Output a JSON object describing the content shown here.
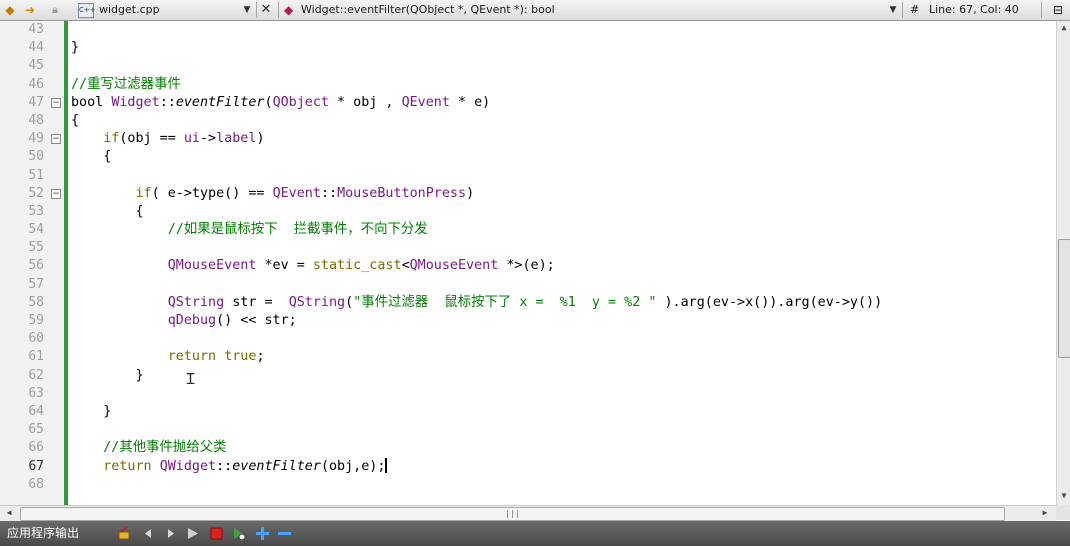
{
  "toolbar": {
    "file_name": "widget.cpp",
    "file_icon_text": "C++",
    "function_signature": "Widget::eventFilter(QObject *, QEvent *): bool",
    "hash_symbol": "#",
    "position": "Line: 67, Col: 40"
  },
  "editor": {
    "lines": [
      {
        "num": "43",
        "code": []
      },
      {
        "num": "44",
        "code": [
          [
            "p",
            "}"
          ]
        ]
      },
      {
        "num": "45",
        "code": []
      },
      {
        "num": "46",
        "code": [
          [
            "cm",
            "//重写过滤器事件"
          ]
        ]
      },
      {
        "num": "47",
        "fold": "-",
        "code": [
          [
            "p",
            "bool "
          ],
          [
            "ty",
            "Widget"
          ],
          [
            "p",
            "::"
          ],
          [
            "fn",
            "eventFilter"
          ],
          [
            "p",
            "("
          ],
          [
            "ty",
            "QObject"
          ],
          [
            "p",
            " * obj , "
          ],
          [
            "ty",
            "QEvent"
          ],
          [
            "p",
            " * e)"
          ]
        ]
      },
      {
        "num": "48",
        "code": [
          [
            "p",
            "{"
          ]
        ]
      },
      {
        "num": "49",
        "fold": "-",
        "code": [
          [
            "p",
            "    "
          ],
          [
            "kw",
            "if"
          ],
          [
            "p",
            "(obj == "
          ],
          [
            "ty",
            "ui"
          ],
          [
            "p",
            "->"
          ],
          [
            "ty",
            "label"
          ],
          [
            "p",
            ")"
          ]
        ]
      },
      {
        "num": "50",
        "code": [
          [
            "p",
            "    {"
          ]
        ]
      },
      {
        "num": "51",
        "code": []
      },
      {
        "num": "52",
        "fold": "-",
        "code": [
          [
            "p",
            "        "
          ],
          [
            "kw",
            "if"
          ],
          [
            "p",
            "( e->type() == "
          ],
          [
            "ty",
            "QEvent"
          ],
          [
            "p",
            "::"
          ],
          [
            "ty",
            "MouseButtonPress"
          ],
          [
            "p",
            ")"
          ]
        ]
      },
      {
        "num": "53",
        "code": [
          [
            "p",
            "        {"
          ]
        ]
      },
      {
        "num": "54",
        "code": [
          [
            "p",
            "            "
          ],
          [
            "cm",
            "//如果是鼠标按下  拦截事件，不向下分发"
          ]
        ]
      },
      {
        "num": "55",
        "code": []
      },
      {
        "num": "56",
        "code": [
          [
            "p",
            "            "
          ],
          [
            "ty",
            "QMouseEvent"
          ],
          [
            "p",
            " *ev = "
          ],
          [
            "kw",
            "static_cast"
          ],
          [
            "p",
            "<"
          ],
          [
            "ty",
            "QMouseEvent"
          ],
          [
            "p",
            " *>(e);"
          ]
        ]
      },
      {
        "num": "57",
        "code": []
      },
      {
        "num": "58",
        "code": [
          [
            "p",
            "            "
          ],
          [
            "ty",
            "QString"
          ],
          [
            "p",
            " str =  "
          ],
          [
            "ty",
            "QString"
          ],
          [
            "p",
            "("
          ],
          [
            "st",
            "\"事件过滤器  鼠标按下了 x =  %1  y = %2 \""
          ],
          [
            "p",
            " ).arg(ev->x()).arg(ev->y())"
          ]
        ]
      },
      {
        "num": "59",
        "code": [
          [
            "p",
            "            "
          ],
          [
            "ty",
            "qDebug"
          ],
          [
            "p",
            "() << str;"
          ]
        ]
      },
      {
        "num": "60",
        "code": []
      },
      {
        "num": "61",
        "code": [
          [
            "p",
            "            "
          ],
          [
            "kw",
            "return"
          ],
          [
            "p",
            " "
          ],
          [
            "kw",
            "true"
          ],
          [
            "p",
            ";"
          ]
        ]
      },
      {
        "num": "62",
        "code": [
          [
            "p",
            "        }"
          ]
        ]
      },
      {
        "num": "63",
        "code": []
      },
      {
        "num": "64",
        "code": [
          [
            "p",
            "    }"
          ]
        ]
      },
      {
        "num": "65",
        "code": []
      },
      {
        "num": "66",
        "code": [
          [
            "p",
            "    "
          ],
          [
            "cm",
            "//其他事件抛给父类"
          ]
        ]
      },
      {
        "num": "67",
        "current": true,
        "cursor": true,
        "code": [
          [
            "p",
            "    "
          ],
          [
            "kw",
            "return"
          ],
          [
            "p",
            " "
          ],
          [
            "ty",
            "QWidget"
          ],
          [
            "p",
            "::"
          ],
          [
            "fn",
            "eventFilter"
          ],
          [
            "p",
            "(obj,e);"
          ]
        ]
      },
      {
        "num": "68",
        "code": []
      }
    ]
  },
  "output_bar": {
    "title": "应用程序输出"
  },
  "icons": {
    "back": "arrow-left-icon",
    "forward": "arrow-right-icon",
    "lock": "lock-icon",
    "file": "cpp-file-icon",
    "close": "close-icon",
    "function": "function-icon",
    "split": "split-window-icon",
    "output_buttons": [
      "clear-output-icon",
      "previous-item-icon",
      "next-item-icon",
      "run-icon",
      "stop-icon",
      "attach-icon",
      "zoom-in-icon",
      "zoom-out-icon"
    ]
  },
  "colors": {
    "keyword": "#7b6b00",
    "type": "#7a1a8a",
    "comment": "#008000",
    "change_bar": "#2e9a3a"
  }
}
